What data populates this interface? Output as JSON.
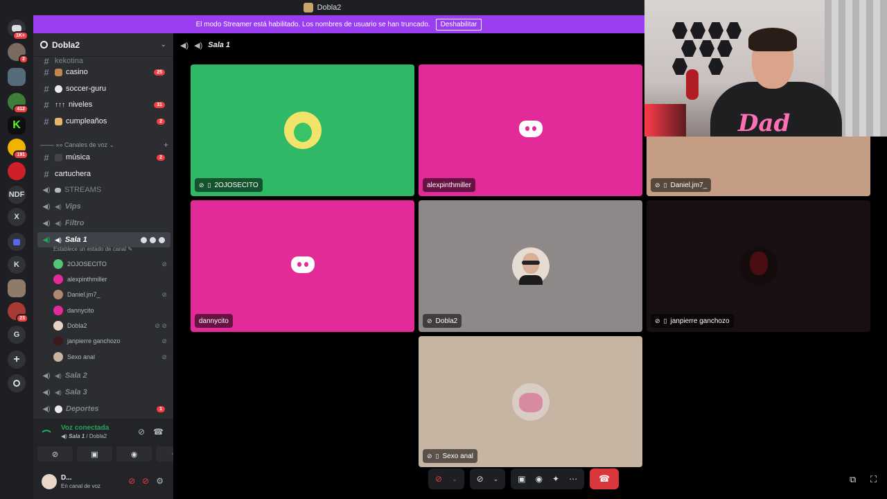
{
  "window": {
    "title": "Dobla2"
  },
  "banner": {
    "text": "El modo Streamer está habilitado. Los nombres de usuario se han truncado.",
    "button": "Deshabilitar"
  },
  "rail": {
    "badges": {
      "b1": "1K+",
      "b2": "2",
      "b3": "412",
      "b4": "191",
      "b5": "23"
    },
    "letters": {
      "ndf": "NDF",
      "x": "X",
      "k": "K",
      "g": "G"
    }
  },
  "sidebar": {
    "server_name": "Dobla2",
    "text_channels": [
      {
        "name": "casino",
        "count": "25"
      },
      {
        "name": "soccer-guru",
        "count": ""
      },
      {
        "name": "niveles",
        "count": "31"
      },
      {
        "name": "cumpleaños",
        "count": "2"
      }
    ],
    "partial_top": "kekotina",
    "voice_category": "Canales de voz",
    "musica": {
      "name": "música",
      "count": "2"
    },
    "cartuchera": "cartuchera",
    "streams": "STREAMS",
    "vips": "Vips",
    "filtro": "Filtro",
    "sala1": "Sala 1",
    "status_hint": "Establece un estado de canal",
    "members": [
      "2OJOSECITO",
      "alexpinthmiller",
      "Daniel.jm7_",
      "dannycito",
      "Dobla2",
      "janpierre ganchozo",
      "Sexo anal"
    ],
    "sala2": "Sala 2",
    "sala3": "Sala 3",
    "deportes": {
      "name": "Deportes",
      "count": "1"
    }
  },
  "voice_panel": {
    "title": "Voz conectada",
    "channel": "Sala 1",
    "server": "Dobla2"
  },
  "user_panel": {
    "name": "D...",
    "status": "En canal de voz"
  },
  "main": {
    "channel": "Sala 1",
    "tiles": [
      {
        "name": "2OJOSECITO",
        "bg": "#2fb866"
      },
      {
        "name": "alexpinthmiller",
        "bg": "#e22a98"
      },
      {
        "name": "Daniel.jm7_",
        "bg": "#c49d84"
      },
      {
        "name": "dannycito",
        "bg": "#e22a98"
      },
      {
        "name": "Dobla2",
        "bg": "#8e8889"
      },
      {
        "name": "janpierre ganchozo",
        "bg": "#170f11"
      },
      {
        "name": "Sexo anal",
        "bg": "#c7b5a4"
      }
    ]
  },
  "webcam": {
    "shirt_text": "Dad"
  },
  "colors": {
    "accent": "#9b3df0",
    "connected": "#23a55a",
    "danger": "#da373c",
    "badge": "#f23f43"
  }
}
